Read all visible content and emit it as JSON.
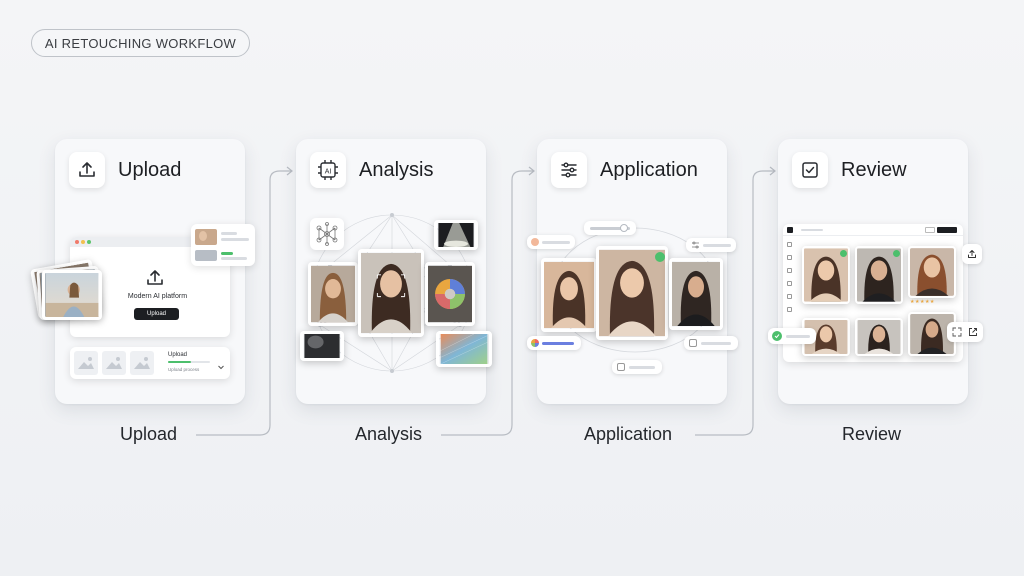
{
  "badge": "AI RETOUCHING WORKFLOW",
  "steps": [
    {
      "title": "Upload",
      "label": "Upload",
      "icon": "upload-icon"
    },
    {
      "title": "Analysis",
      "label": "Analysis",
      "icon": "ai-chip-icon"
    },
    {
      "title": "Application",
      "label": "Application",
      "icon": "sliders-icon"
    },
    {
      "title": "Review",
      "label": "Review",
      "icon": "checkbox-icon"
    }
  ],
  "upload_card": {
    "platform_text": "Modern AI platform",
    "button_label": "Upload",
    "progress_title": "Upload",
    "progress_subtitle": "Upload process",
    "progress_value": 0.55
  },
  "colors": {
    "accent_green": "#4cbf6c",
    "accent_blue": "#6b7fe0",
    "dark": "#1c1e22"
  }
}
